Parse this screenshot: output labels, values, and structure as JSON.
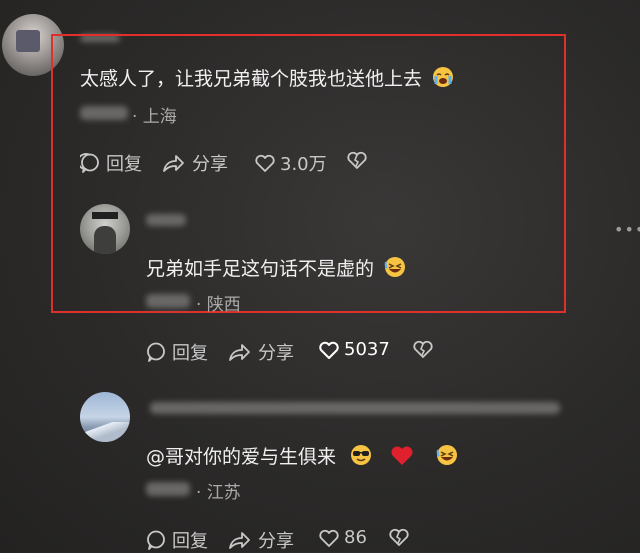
{
  "comment1": {
    "text": "太感人了，让我兄弟截个肢我也送他上去",
    "emoji": "crying-face",
    "location": "· 上海",
    "actions": {
      "reply": "回复",
      "share": "分享",
      "likes": "3.0万"
    }
  },
  "reply1": {
    "text": "兄弟如手足这句话不是虚的",
    "emoji": "rolling-laughing",
    "location": "· 陕西",
    "actions": {
      "reply": "回复",
      "share": "分享",
      "likes": "5037"
    }
  },
  "reply2": {
    "text": "@哥对你的爱与生俱来",
    "emojis": [
      "sunglasses-face",
      "red-heart",
      "rolling-laughing"
    ],
    "location": "· 江苏",
    "actions": {
      "reply": "回复",
      "share": "分享",
      "likes": "86"
    }
  },
  "colors": {
    "highlight": "#e0302c",
    "heart": "#e0202c",
    "background": "#2b2a29"
  }
}
